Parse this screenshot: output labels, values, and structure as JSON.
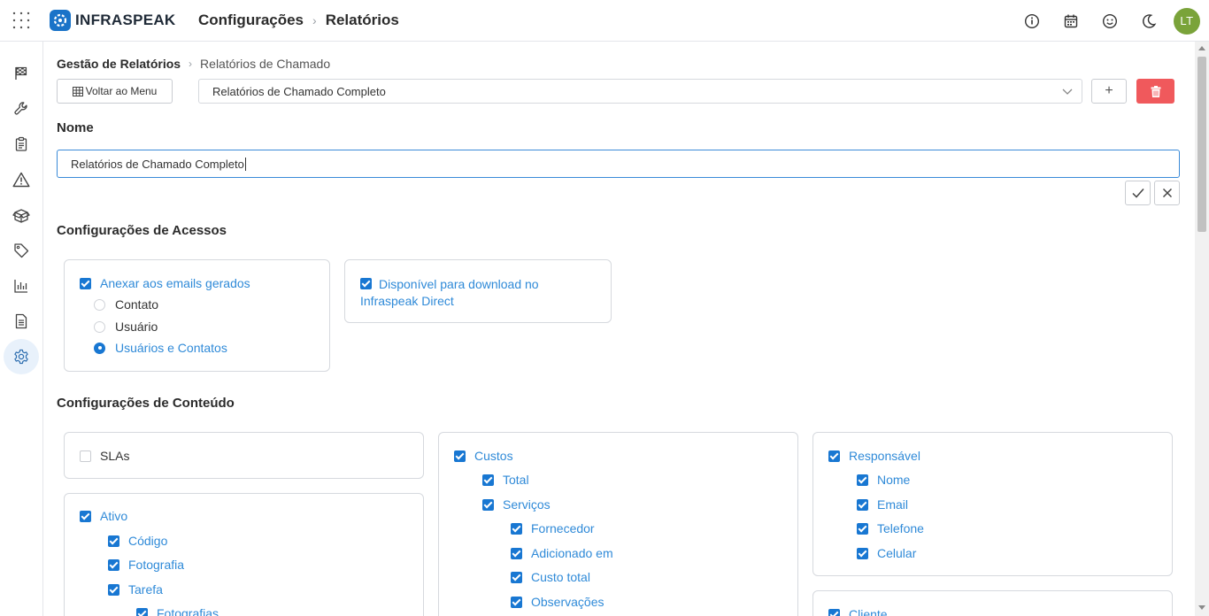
{
  "header": {
    "brand": "INFRASPEAK",
    "breadcrumb": [
      "Configurações",
      "Relatórios"
    ],
    "avatar_initials": "LT"
  },
  "sidebar": {
    "items": [
      "flag-icon",
      "wrench-icon",
      "clipboard-icon",
      "warning-icon",
      "box-icon",
      "tag-icon",
      "chart-icon",
      "document-icon",
      "gear-icon"
    ],
    "active": "gear-icon"
  },
  "page": {
    "breadcrumb_root": "Gestão de Relatórios",
    "breadcrumb_current": "Relatórios de Chamado",
    "back_button": "Voltar ao Menu",
    "report_select_value": "Relatórios de Chamado Completo",
    "add_button": "+",
    "name_label": "Nome",
    "name_value": "Relatórios de Chamado Completo"
  },
  "access": {
    "title": "Configurações de Acessos",
    "attach_label": "Anexar aos emails gerados",
    "recipient_options": [
      "Contato",
      "Usuário",
      "Usuários e Contatos"
    ],
    "recipient_selected": "Usuários e Contatos",
    "download_line1": "Disponível para download no",
    "download_line2": "Infraspeak Direct"
  },
  "content": {
    "title": "Configurações de Conteúdo",
    "slas": "SLAs",
    "ativo": {
      "label": "Ativo",
      "children": [
        "Código",
        "Fotografia",
        "Tarefa"
      ],
      "grandchild": "Fotografias"
    },
    "custos": {
      "label": "Custos",
      "total": "Total",
      "servicos": "Serviços",
      "servicos_children": [
        "Fornecedor",
        "Adicionado em",
        "Custo total",
        "Observações"
      ]
    },
    "responsavel": {
      "label": "Responsável",
      "children": [
        "Nome",
        "Email",
        "Telefone",
        "Celular"
      ]
    },
    "cliente": "Cliente"
  }
}
